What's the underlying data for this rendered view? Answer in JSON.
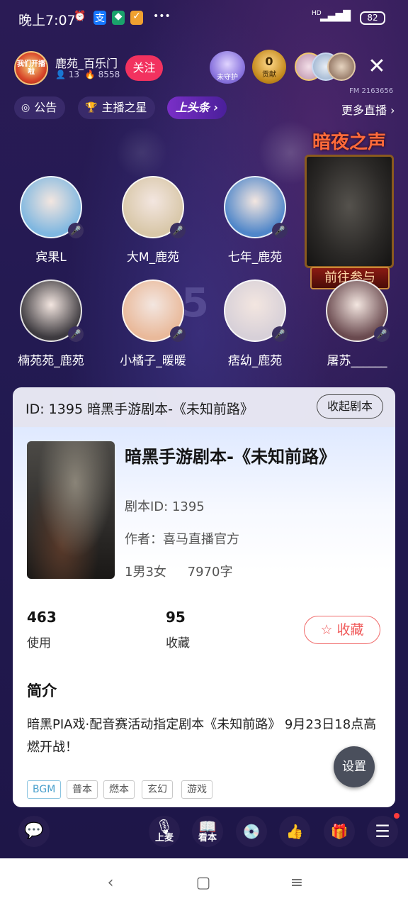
{
  "status_bar": {
    "time": "晚上7:07",
    "battery": "82",
    "network": "HD",
    "icons": [
      "alarm-icon",
      "alipay-icon",
      "shield-app-icon",
      "task-app-icon",
      "more-dots-icon",
      "signal-icon",
      "wifi-icon",
      "battery-icon"
    ]
  },
  "header": {
    "host_name": "鹿苑_百乐门",
    "host_avatar_text": "我们开播啦",
    "fans_count": "13",
    "heat": "8558",
    "follow_label": "关注",
    "guard_label": "未守护",
    "contrib_value": "0",
    "contrib_label": "贡献",
    "fm_id": "FM 2163656",
    "close_icon": "close-icon"
  },
  "nav": {
    "notice": "公告",
    "anchor_star": "主播之星",
    "headline": "上头条",
    "more_live": "更多直播"
  },
  "event": {
    "title": "暗夜之声",
    "button": "前往参与"
  },
  "seats": [
    {
      "name": "宾果L",
      "color": "#7fb7e0"
    },
    {
      "name": "大M_鹿苑",
      "color": "#d8c7a8"
    },
    {
      "name": "七年_鹿苑",
      "color": "#4f86c9"
    },
    {
      "name": "楠苑苑_鹿苑",
      "color": "#3d3a3f"
    },
    {
      "name": "小橘子_暖暖",
      "color": "#e9b99a"
    },
    {
      "name": "痞幼_鹿苑",
      "color": "#d7d0d8"
    },
    {
      "name": "屠苏______",
      "color": "#6a4a4f"
    }
  ],
  "stage_number": "5",
  "script_panel": {
    "header_title": "ID: 1395 暗黑手游剧本-《未知前路》",
    "collapse_label": "收起剧本",
    "title": "暗黑手游剧本-《未知前路》",
    "script_id": "剧本ID: 1395",
    "author": "作者：喜马直播官方",
    "cast": "1男3女",
    "word_count": "7970字",
    "uses_value": "463",
    "uses_label": "使用",
    "favs_value": "95",
    "favs_label": "收藏",
    "fav_button": "☆ 收藏",
    "intro_title": "简介",
    "intro_text": "暗黑PIA戏·配音赛活动指定剧本《未知前路》 9月23日18点高燃开战！",
    "tags": [
      "BGM",
      "普本",
      "燃本",
      "玄幻",
      "游戏"
    ]
  },
  "settings_label": "设置",
  "toolbar": {
    "mic_label": "上麦",
    "script_label": "看本"
  },
  "colors": {
    "accent_red": "#f2325f",
    "background": "#231a52",
    "fav_red": "#f05a5a"
  }
}
